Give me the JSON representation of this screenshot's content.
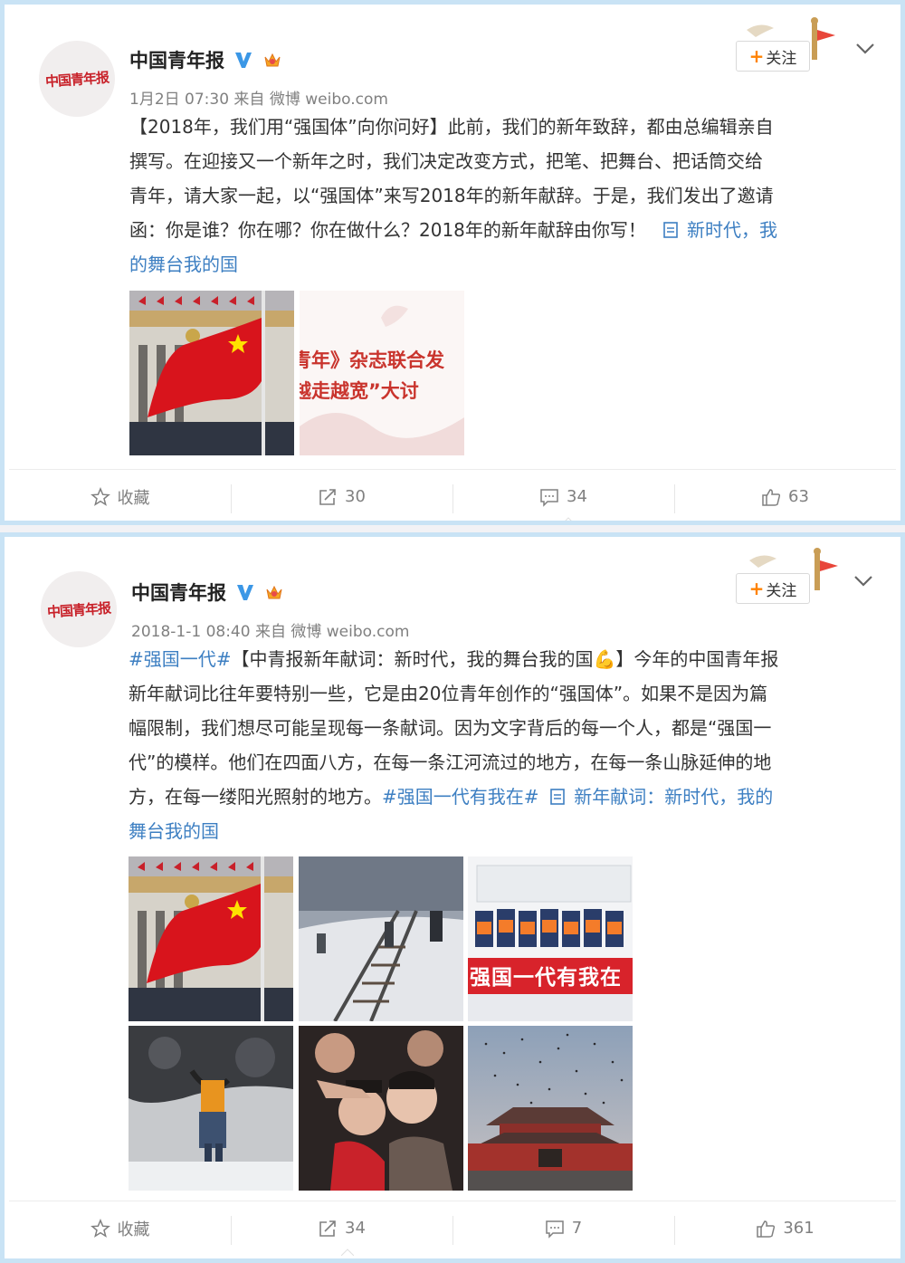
{
  "posts": [
    {
      "username": "中国青年报",
      "avatar_text": "中国青年报",
      "meta": "1月2日 07:30 来自 微博 weibo.com",
      "follow_label": "关注",
      "follow_plus": "+",
      "text_lines": [
        "【2018年，我们用“强国体”向你问好】此前，我们的新年致辞，都由总编辑亲自",
        "撰写。在迎接又一个新年之时，我们决定改变方式，把笔、把舞台、把话筒交给",
        "青年，请大家一起，以“强国体”来写2018年的新年献辞。于是，我们发出了邀请",
        "函：你是谁？你在哪？你在做什么？2018年的新年献辞由你写！"
      ],
      "article_link_a": "新时代，我",
      "article_link_b": "的舞台我的国",
      "image2_text": [
        "青年》杂志联合发",
        "越走越宽”大讨"
      ],
      "actions": {
        "favorite": "收藏",
        "repost": "30",
        "comment": "34",
        "like": "63"
      }
    },
    {
      "username": "中国青年报",
      "avatar_text": "中国青年报",
      "meta": "2018-1-1 08:40 来自 微博 weibo.com",
      "follow_label": "关注",
      "follow_plus": "+",
      "hashtag1": "#强国一代#",
      "line1_rest": "【中青报新年献词：新时代，我的舞台我的国",
      "muscle_emoji": "💪",
      "line1_end": "】今年的中国青年报",
      "text_lines": [
        "新年献词比往年要特别一些，它是由20位青年创作的“强国体”。如果不是因为篇",
        "幅限制，我们想尽可能呈现每一条献词。因为文字背后的每一个人，都是“强国一",
        "代”的模样。他们在四面八方，在每一条江河流过的地方，在每一条山脉延伸的地"
      ],
      "line5_start": "方，在每一缕阳光照射的地方。",
      "hashtag2": "#强国一代有我在#",
      "article_link_a": "新年献词：新时代，我的",
      "article_link_b": "舞台我的国",
      "banner_text": "强国一代有我在",
      "actions": {
        "favorite": "收藏",
        "repost": "34",
        "comment": "7",
        "like": "361"
      }
    }
  ],
  "colors": {
    "link": "#3d7fc2",
    "accent": "#ff8200",
    "border": "#c9e3f5"
  }
}
